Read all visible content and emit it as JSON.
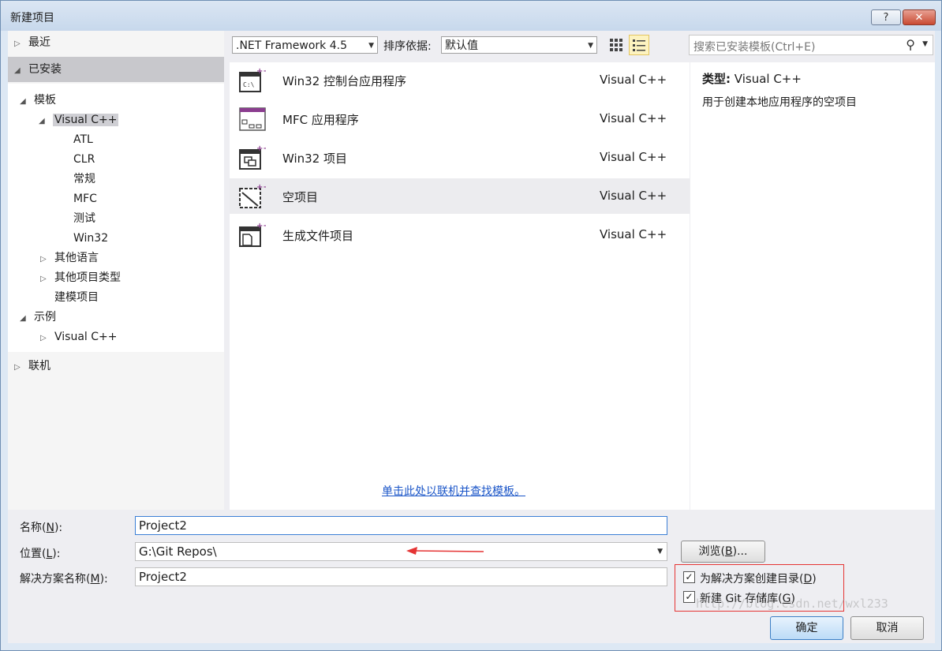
{
  "window": {
    "title": "新建项目",
    "help_symbol": "?",
    "close_symbol": "✕"
  },
  "tree": {
    "recent": "最近",
    "installed": "已安装",
    "templates": "模板",
    "visual_cpp": "Visual C++",
    "atl": "ATL",
    "clr": "CLR",
    "general": "常规",
    "mfc": "MFC",
    "test": "测试",
    "win32": "Win32",
    "other_languages": "其他语言",
    "other_project_types": "其他项目类型",
    "modeling": "建模项目",
    "samples": "示例",
    "samples_vc": "Visual C++",
    "online": "联机"
  },
  "toolbar": {
    "framework": ".NET Framework 4.5",
    "sort_label": "排序依据:",
    "sort_value": "默认值",
    "search_placeholder": "搜索已安装模板(Ctrl+E)"
  },
  "templates": [
    {
      "name": "Win32 控制台应用程序",
      "lang": "Visual C++"
    },
    {
      "name": "MFC 应用程序",
      "lang": "Visual C++"
    },
    {
      "name": "Win32 项目",
      "lang": "Visual C++"
    },
    {
      "name": "空项目",
      "lang": "Visual C++"
    },
    {
      "name": "生成文件项目",
      "lang": "Visual C++"
    }
  ],
  "online_link": "单击此处以联机并查找模板。",
  "description": {
    "type_label": "类型:",
    "type_value": "Visual C++",
    "text": "用于创建本地应用程序的空项目"
  },
  "form": {
    "name_label": "名称(",
    "name_key": "N",
    "name_label_end": "):",
    "name_value": "Project2",
    "location_label": "位置(",
    "location_key": "L",
    "location_label_end": "):",
    "location_value": "G:\\Git Repos\\",
    "solution_label": "解决方案名称(",
    "solution_key": "M",
    "solution_label_end": "):",
    "solution_value": "Project2",
    "browse": "浏览(",
    "browse_key": "B",
    "browse_end": ")...",
    "create_dir": "为解决方案创建目录(",
    "create_dir_key": "D",
    "create_dir_end": ")",
    "create_dir_checked": true,
    "git": "新建 Git 存储库(",
    "git_key": "G",
    "git_end": ")",
    "git_checked": true
  },
  "buttons": {
    "ok": "确定",
    "cancel": "取消"
  },
  "watermark": "http://blog.csdn.net/wxl233",
  "colors": {
    "accent": "#1a55c8",
    "highlight": "#e53434",
    "purple": "#8b3d8f"
  }
}
